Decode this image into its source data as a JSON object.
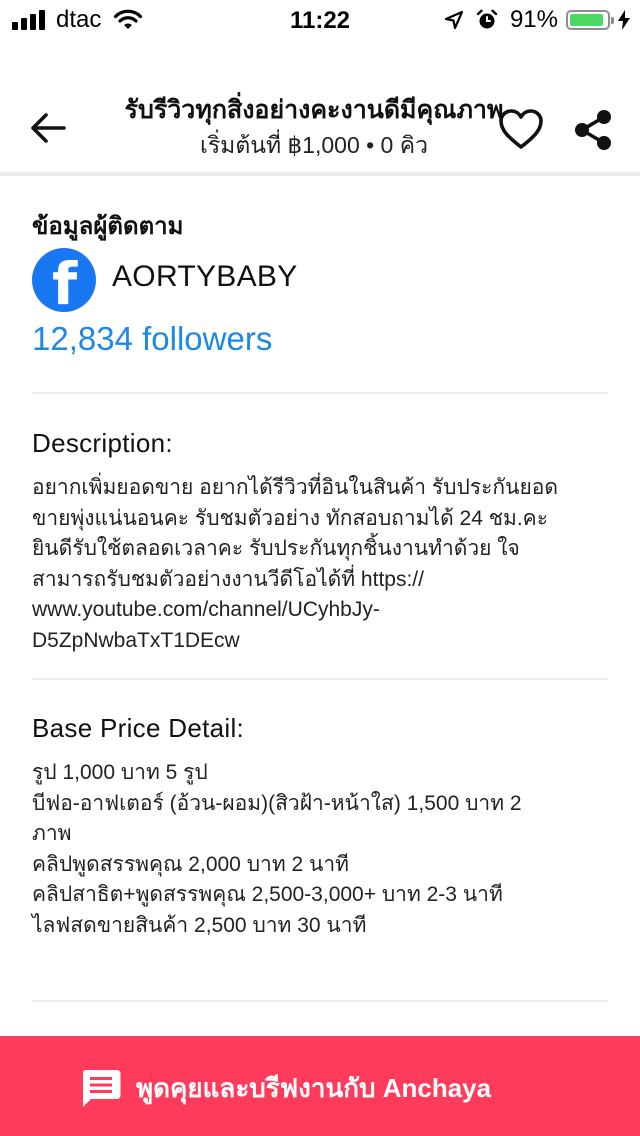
{
  "status_bar": {
    "carrier": "dtac",
    "time": "11:22",
    "battery_percent": "91%",
    "battery_level": 0.91,
    "icons": [
      "signal-bars-icon",
      "wifi-icon",
      "location-arrow-icon",
      "alarm-icon",
      "battery-icon",
      "charging-bolt-icon"
    ]
  },
  "header": {
    "title": "รับรีวิวทุกสิ่งอย่างคะงานดีมีคุณภาพ",
    "subtitle": "เริ่มต้นที่ ฿1,000 • 0 คิว",
    "icons": {
      "back": "arrow-left-icon",
      "favorite": "heart-outline-icon",
      "share": "share-icon"
    }
  },
  "follower_info": {
    "heading": "ข้อมูลผู้ติดตาม",
    "platform_icon": "facebook-icon",
    "account_name": "AORTYBABY",
    "followers": "12,834 followers",
    "colors": {
      "facebook": "#1877f2",
      "followers_link": "#1e88e5"
    }
  },
  "description": {
    "heading": "Description:",
    "lines": [
      "อยากเพิ่มยอดขาย อยากได้รีวิวที่อินในสินค้า รับประกันยอด",
      "ขายพุ่งแน่นอนคะ รับชมตัวอย่าง ทักสอบถามได้ 24 ชม.คะ",
      "ยินดีรับใช้ตลอดเวลาคะ รับประกันทุกชิ้นงานทำด้วย ใจ",
      "สามารถรับชมตัวอย่างงานวีดีโอได้ที่ https://",
      "www.youtube.com/channel/UCyhbJy-",
      "D5ZpNwbaTxT1DEcw"
    ]
  },
  "base_price": {
    "heading": "Base Price Detail:",
    "lines": [
      "รูป 1,000 บาท 5 รูป",
      "บีฟอ-อาฟเตอร์ (อ้วน-ผอม)(สิวฝ้า-หน้าใส) 1,500 บาท 2",
      "ภาพ",
      "คลิปพูดสรรพคุณ 2,000 บาท 2 นาที",
      "คลิปสาธิต+พูดสรรพคุณ 2,500-3,000+ บาท 2-3 นาที",
      "ไลฟสดขายสินค้า 2,500 บาท 30 นาที"
    ]
  },
  "chat_button": {
    "label": "พูดคุยและบรีฟงานกับ Anchaya",
    "icon": "chat-message-icon",
    "color": "#ff3b5c"
  }
}
